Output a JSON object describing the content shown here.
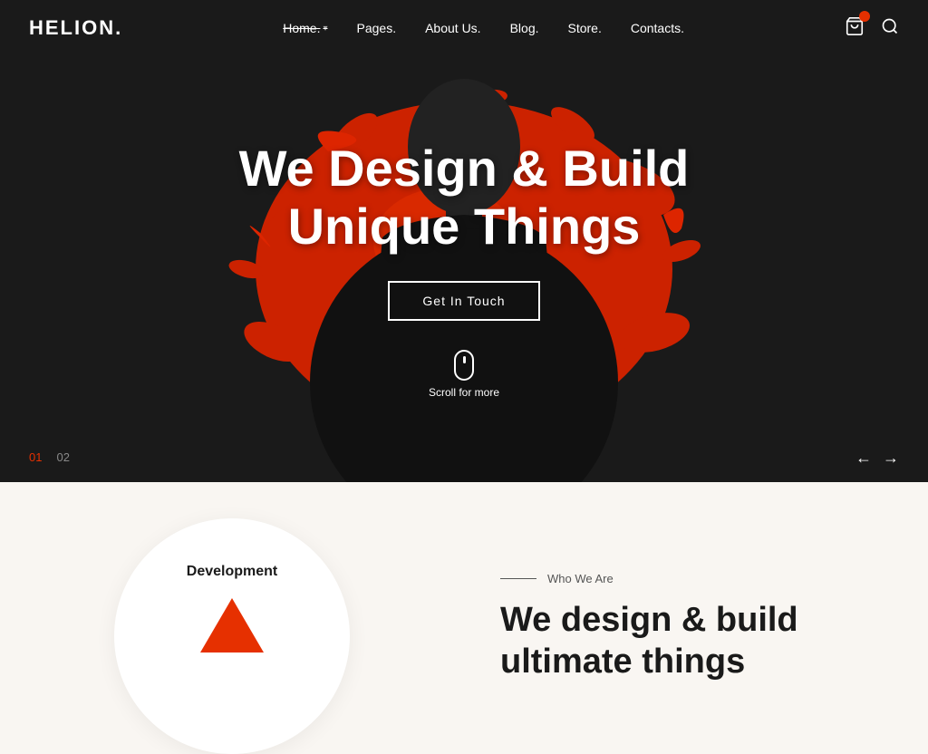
{
  "header": {
    "logo": "HELION.",
    "nav": [
      {
        "label": "Home.",
        "active": true,
        "has_dropdown": true
      },
      {
        "label": "Pages.",
        "active": false,
        "has_dropdown": false
      },
      {
        "label": "About Us.",
        "active": false,
        "has_dropdown": false
      },
      {
        "label": "Blog.",
        "active": false,
        "has_dropdown": false
      },
      {
        "label": "Store.",
        "active": false,
        "has_dropdown": false
      },
      {
        "label": "Contacts.",
        "active": false,
        "has_dropdown": false
      }
    ]
  },
  "hero": {
    "title_line1": "We Design & Build",
    "title_line2": "Unique Things",
    "cta_label": "Get In Touch",
    "scroll_label": "Scroll for more",
    "slide_current": "01",
    "slide_next": "02",
    "arrow_prev": "←",
    "arrow_next": "→"
  },
  "below": {
    "dev_label": "Development",
    "eyebrow_line": "Who We Are",
    "section_title_line1": "We design & build",
    "section_title_line2": "ultimate things"
  }
}
